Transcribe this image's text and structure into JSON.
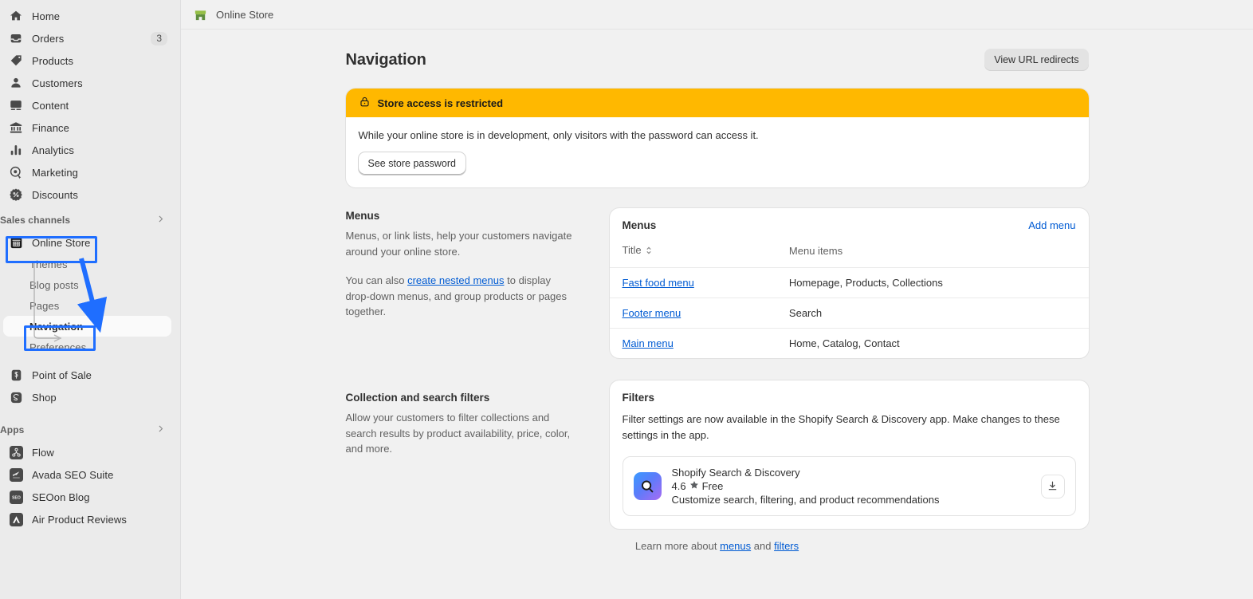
{
  "sidebar": {
    "main_items": [
      {
        "label": "Home",
        "icon": "home-icon",
        "badge": null
      },
      {
        "label": "Orders",
        "icon": "orders-inbox-icon",
        "badge": "3"
      },
      {
        "label": "Products",
        "icon": "price-tag-icon",
        "badge": null
      },
      {
        "label": "Customers",
        "icon": "person-icon",
        "badge": null
      },
      {
        "label": "Content",
        "icon": "image-content-icon",
        "badge": null
      },
      {
        "label": "Finance",
        "icon": "bank-icon",
        "badge": null
      },
      {
        "label": "Analytics",
        "icon": "bar-chart-icon",
        "badge": null
      },
      {
        "label": "Marketing",
        "icon": "target-cursor-icon",
        "badge": null
      },
      {
        "label": "Discounts",
        "icon": "discount-badge-icon",
        "badge": null
      }
    ],
    "sales_channels": {
      "label": "Sales channels",
      "expand_icon": "chevron-right-icon",
      "items": [
        {
          "label": "Online Store",
          "icon": "storefront-icon"
        },
        {
          "label": "Themes"
        },
        {
          "label": "Blog posts"
        },
        {
          "label": "Pages"
        },
        {
          "label": "Navigation",
          "active": true
        },
        {
          "label": "Preferences"
        },
        {
          "label": "Point of Sale",
          "icon": "pos-icon"
        },
        {
          "label": "Shop",
          "icon": "shop-icon"
        }
      ]
    },
    "apps": {
      "label": "Apps",
      "expand_icon": "chevron-right-icon",
      "items": [
        {
          "label": "Flow",
          "icon": "flow-app-icon"
        },
        {
          "label": "Avada SEO Suite",
          "icon": "avada-app-icon"
        },
        {
          "label": "SEOon Blog",
          "icon": "seoon-app-icon"
        },
        {
          "label": "Air Product Reviews",
          "icon": "air-reviews-app-icon"
        }
      ]
    }
  },
  "topbar": {
    "title": "Online Store",
    "icon": "green-store-icon"
  },
  "page": {
    "title": "Navigation",
    "view_redirects_label": "View URL redirects"
  },
  "banner": {
    "icon": "lock-icon",
    "title": "Store access is restricted",
    "body": "While your online store is in development, only visitors with the password can access it.",
    "button_label": "See store password",
    "accent_color": "#ffb800"
  },
  "menus_section": {
    "heading": "Menus",
    "paragraph_1": "Menus, or link lists, help your customers navigate around your online store.",
    "paragraph_2_prefix": "You can also ",
    "paragraph_2_link": "create nested menus",
    "paragraph_2_suffix": " to display drop-down menus, and group products or pages together.",
    "card_title": "Menus",
    "add_menu_label": "Add menu",
    "columns": [
      "Title",
      "Menu items"
    ],
    "sort_icon": "sort-chevrons-icon",
    "rows": [
      {
        "title": "Fast food menu",
        "items": "Homepage, Products, Collections"
      },
      {
        "title": "Footer menu",
        "items": "Search"
      },
      {
        "title": "Main menu",
        "items": "Home, Catalog, Contact"
      }
    ]
  },
  "filters_section": {
    "heading": "Collection and search filters",
    "paragraph": "Allow your customers to filter collections and search results by product availability, price, color, and more.",
    "card_title": "Filters",
    "card_description": "Filter settings are now available in the Shopify Search & Discovery app. Make changes to these settings in the app.",
    "app": {
      "icon": "search-discovery-app-icon",
      "name": "Shopify Search & Discovery",
      "rating": "4.6",
      "rating_icon": "star-icon",
      "price": "Free",
      "description": "Customize search, filtering, and product recommendations",
      "action_icon": "download-icon"
    }
  },
  "footer": {
    "prefix": "Learn more about ",
    "link_1": "menus",
    "middle": " and ",
    "link_2": "filters"
  },
  "annotations": {
    "box_1_target": "Online Store",
    "box_2_target": "Navigation",
    "color": "#1f6eff"
  }
}
